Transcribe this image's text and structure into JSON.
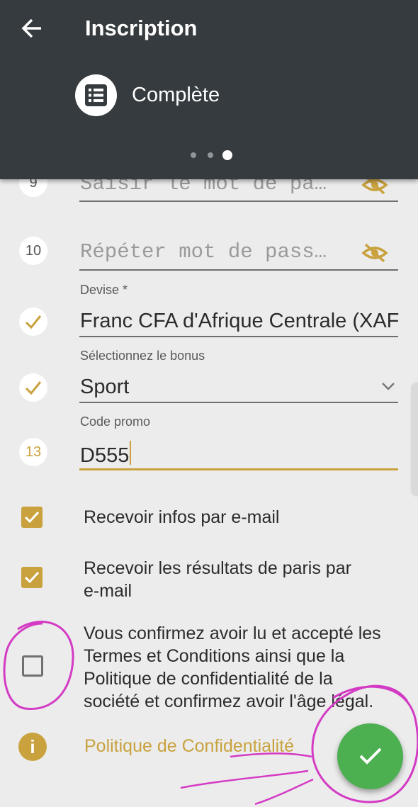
{
  "header": {
    "title": "Inscription",
    "step_label": "Complète",
    "dots": 3,
    "active_dot": 3
  },
  "form": {
    "password": {
      "number": "9",
      "placeholder": "Saisir le mot de pa…"
    },
    "repeat_password": {
      "number": "10",
      "placeholder": "Répéter mot de pass…"
    },
    "currency": {
      "label": "Devise *",
      "value": "Franc CFA d'Afrique Centrale (XAF)"
    },
    "bonus": {
      "label": "Sélectionnez le bonus",
      "value": "Sport"
    },
    "promo": {
      "number": "13",
      "label": "Code promo",
      "value": "D555"
    }
  },
  "checkboxes": {
    "email_info": {
      "label": "Recevoir infos par e-mail",
      "checked": true
    },
    "bet_results": {
      "line1": "Recevoir les résultats de paris par",
      "line2": "e-mail",
      "checked": true
    },
    "terms": {
      "line1": "Vous confirmez avoir lu et accepté les",
      "line2": "Termes et Conditions ainsi que la",
      "line3": "Politique de confidentialité de la",
      "line4": "société et confirmez avoir l'âge légal.",
      "checked": false
    }
  },
  "footer": {
    "info_icon": "i",
    "policy_link": "Politique de Confidentialité"
  },
  "colors": {
    "header_bg": "#353b3e",
    "accent": "#c9a23e",
    "fab": "#4caf50",
    "annotation": "#d43bc4"
  },
  "icons": [
    "back-arrow-icon",
    "list-icon",
    "eye-off-icon",
    "check-icon",
    "chevron-down-icon",
    "info-icon"
  ]
}
